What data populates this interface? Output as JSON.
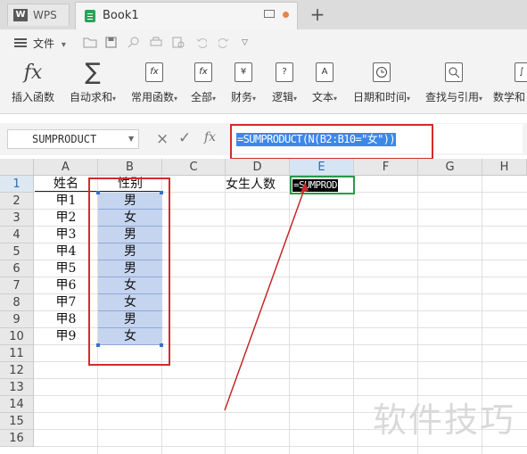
{
  "titlebar": {
    "app_tab": "WPS",
    "app_logo": "W",
    "doc_tab": "Book1",
    "new_tab": "+"
  },
  "menu": {
    "file": "文件",
    "file_arrow": "▾"
  },
  "ribbon": {
    "items": [
      {
        "label": "插入函数",
        "icon": "fx-icon"
      },
      {
        "label": "自动求和",
        "icon": "sum-icon"
      },
      {
        "label": "常用函数",
        "icon": "star-fx-icon"
      },
      {
        "label": "全部",
        "icon": "fx-box-icon"
      },
      {
        "label": "财务",
        "icon": "yen-icon"
      },
      {
        "label": "逻辑",
        "icon": "question-icon"
      },
      {
        "label": "文本",
        "icon": "text-a-icon"
      },
      {
        "label": "日期和时间",
        "icon": "clock-icon"
      },
      {
        "label": "查找与引用",
        "icon": "search-doc-icon"
      },
      {
        "label": "数学和",
        "icon": "math-icon"
      }
    ]
  },
  "formula_bar": {
    "name_box": "SUMPRODUCT",
    "cancel": "×",
    "confirm": "✓",
    "fx": "fx",
    "formula": "=SUMPRODUCT(N(B2:B10=\"女\"))"
  },
  "sheet": {
    "columns": [
      "A",
      "B",
      "C",
      "D",
      "E",
      "F",
      "G",
      "H"
    ],
    "rows": [
      "1",
      "2",
      "3",
      "4",
      "5",
      "6",
      "7",
      "8",
      "9",
      "10",
      "11",
      "12",
      "13",
      "14",
      "15",
      "16"
    ],
    "col_a": [
      "姓名",
      "甲1",
      "甲2",
      "甲3",
      "甲4",
      "甲5",
      "甲6",
      "甲7",
      "甲8",
      "甲9"
    ],
    "col_b": [
      "性别",
      "男",
      "女",
      "男",
      "男",
      "男",
      "女",
      "女",
      "男",
      "女"
    ],
    "d1": "女生人数",
    "e1": "=SUMPROD"
  },
  "watermark": "软件技巧",
  "colors": {
    "selection": "#c6d5ef",
    "highlight_red": "#d62a2a",
    "active_cell": "#2a9a4a",
    "formula_select": "#3b88e8"
  }
}
